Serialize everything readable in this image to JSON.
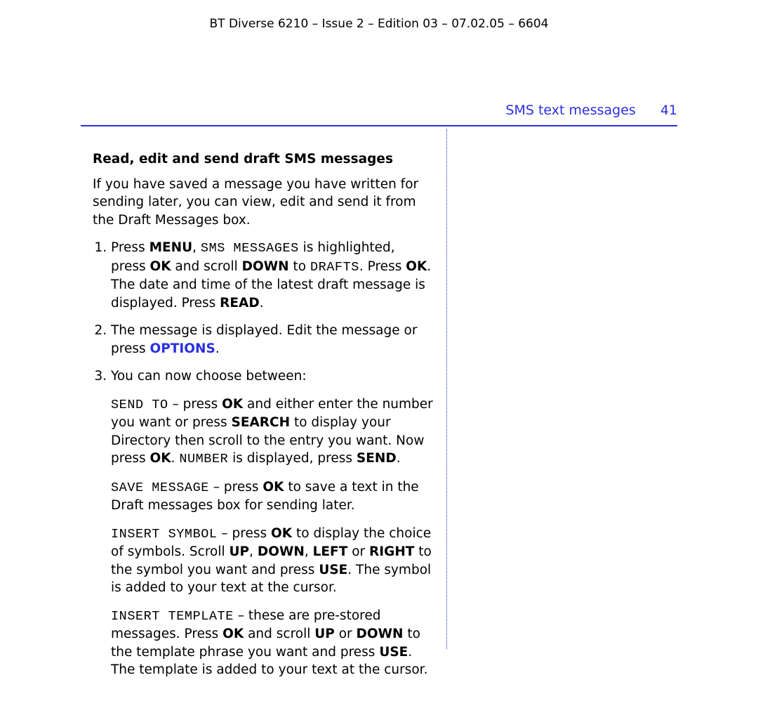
{
  "doc_header": "BT Diverse 6210 – Issue 2 – Edition 03 – 07.02.05 – 6604",
  "section": {
    "title": "SMS text messages",
    "page": "41"
  },
  "heading": "Read, edit and send draft SMS messages",
  "intro": "If you have saved a message you have written for sending later, you can view, edit and send it from the Draft Messages box.",
  "step1": {
    "t1": "Press ",
    "b1": "MENU",
    "t2": ", ",
    "k1": "SMS MESSAGES",
    "t3": " is highlighted, press ",
    "b2": "OK",
    "t4": " and scroll ",
    "b3": "DOWN",
    "t5": " to ",
    "k2": "DRAFTS",
    "t6": ". Press ",
    "b4": "OK",
    "t7": ". The date and time of the latest draft message is displayed. Press ",
    "b5": "READ",
    "t8": "."
  },
  "step2": {
    "t1": "The message is displayed. Edit the message or press ",
    "b1": "OPTIONS",
    "t2": "."
  },
  "step3": "You can now choose between:",
  "opt_send": {
    "k1": "SEND TO",
    "t1": " – press ",
    "b1": "OK",
    "t2": " and either enter the number you want or press ",
    "b2": "SEARCH",
    "t3": " to display your Directory then scroll to the entry you want. Now press ",
    "b3": "OK",
    "t4": ". ",
    "k2": "NUMBER",
    "t5": " is displayed, press ",
    "b4": "SEND",
    "t6": "."
  },
  "opt_save": {
    "k1": "SAVE MESSAGE",
    "t1": " – press ",
    "b1": "OK",
    "t2": " to save a text in the Draft messages box for sending later."
  },
  "opt_symbol": {
    "k1": "INSERT SYMBOL",
    "t1": " – press ",
    "b1": "OK",
    "t2": " to display the choice of symbols. Scroll ",
    "b2": "UP",
    "t3": ", ",
    "b3": "DOWN",
    "t4": ", ",
    "b4": "LEFT",
    "t5": " or ",
    "b5": "RIGHT",
    "t6": " to the symbol you want and press ",
    "b6": "USE",
    "t7": ". The symbol is added to your text at the cursor."
  },
  "opt_template": {
    "k1": "INSERT TEMPLATE",
    "t1": " – these are pre-stored messages. Press ",
    "b1": "OK",
    "t2": " and scroll ",
    "b2": "UP",
    "t3": " or ",
    "b3": "DOWN",
    "t4": " to the template phrase you want and press ",
    "b4": "USE",
    "t5": ". The template is added to your text at the cursor."
  }
}
